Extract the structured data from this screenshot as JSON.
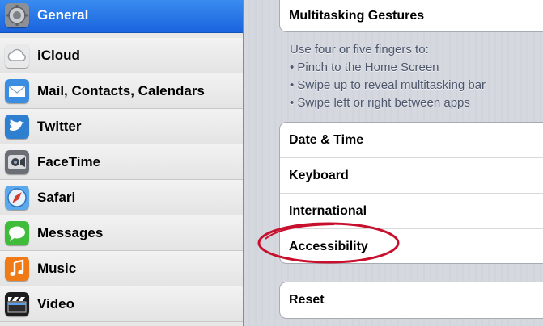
{
  "sidebar": {
    "items": [
      {
        "label": "General",
        "icon": "gear-icon",
        "selected": true
      },
      {
        "label": "iCloud",
        "icon": "cloud-icon",
        "selected": false
      },
      {
        "label": "Mail, Contacts, Calendars",
        "icon": "mail-icon",
        "selected": false
      },
      {
        "label": "Twitter",
        "icon": "twitter-bird-icon",
        "selected": false
      },
      {
        "label": "FaceTime",
        "icon": "video-camera-icon",
        "selected": false
      },
      {
        "label": "Safari",
        "icon": "compass-icon",
        "selected": false
      },
      {
        "label": "Messages",
        "icon": "speech-bubble-icon",
        "selected": false
      },
      {
        "label": "Music",
        "icon": "music-note-icon",
        "selected": false
      },
      {
        "label": "Video",
        "icon": "clapperboard-icon",
        "selected": false
      }
    ]
  },
  "main": {
    "gestures_group": {
      "label": "Multitasking Gestures"
    },
    "gestures_footer": {
      "lines": [
        "Use four or five fingers to:",
        "• Pinch to the Home Screen",
        "• Swipe up to reveal multitasking bar",
        "• Swipe left or right between apps"
      ]
    },
    "settings_group": {
      "items": [
        {
          "label": "Date & Time"
        },
        {
          "label": "Keyboard"
        },
        {
          "label": "International"
        },
        {
          "label": "Accessibility"
        }
      ]
    },
    "reset_group": {
      "label": "Reset"
    }
  },
  "colors": {
    "selection_blue": "#1a63de",
    "annotation_red": "#c8102e",
    "footer_text": "#4c566c"
  }
}
